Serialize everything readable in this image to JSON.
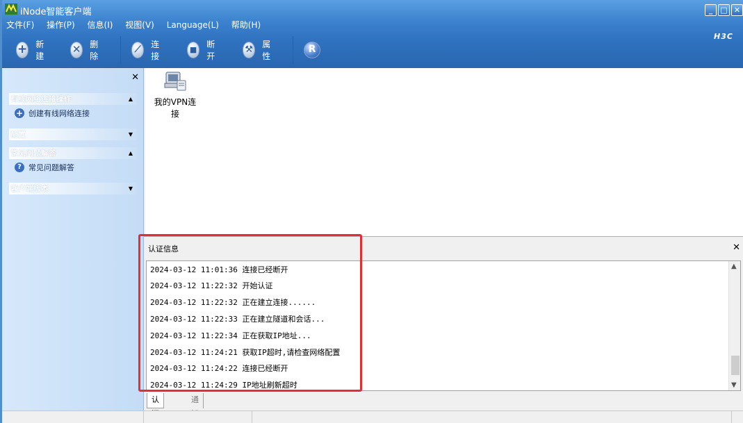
{
  "window": {
    "title": "iNode智能客户端",
    "brand": "H3C"
  },
  "menu": [
    "文件(F)",
    "操作(P)",
    "信息(I)",
    "视图(V)",
    "Language(L)",
    "帮助(H)"
  ],
  "toolbar": {
    "new_label": "新建",
    "delete_label": "删除",
    "connect_label": "连接",
    "disconnect_label": "断开",
    "properties_label": "属性"
  },
  "sidebar": {
    "sections": [
      {
        "title": "有线网络连接操作",
        "items": [
          "创建有线网络连接"
        ]
      },
      {
        "title": "配置",
        "items": []
      },
      {
        "title": "常见问题解答",
        "items": [
          "常见问题解答"
        ]
      },
      {
        "title": "客户端版本",
        "items": []
      }
    ]
  },
  "main": {
    "vpn_label": "我的VPN连接"
  },
  "auth_panel": {
    "title": "认证信息",
    "logs": [
      "2024-03-12 11:01:36 连接已经断开",
      "2024-03-12 11:22:32 开始认证",
      "2024-03-12 11:22:32 正在建立连接......",
      "2024-03-12 11:22:33 正在建立隧道和会话...",
      "2024-03-12 11:22:34 正在获取IP地址...",
      "2024-03-12 11:24:21 获取IP超时,请检查网络配置",
      "2024-03-12 11:24:22 连接已经断开",
      "2024-03-12 11:24:29 IP地址刷新超时"
    ]
  },
  "tabs": [
    "认证信息",
    "通知"
  ],
  "colors": {
    "highlight": "#e03030",
    "title_blue": "#3d83cf"
  }
}
